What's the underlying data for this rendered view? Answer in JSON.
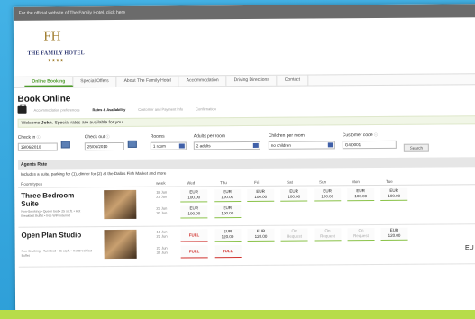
{
  "topbar": {
    "text": "For the official website of The Family Hotel, click here"
  },
  "logo": {
    "mark": "FH",
    "name": "THE FAMILY HOTEL",
    "stars": "★★★★"
  },
  "nav": [
    {
      "label": "Online Booking",
      "active": true
    },
    {
      "label": "Special Offers",
      "active": false
    },
    {
      "label": "About The Family Hotel",
      "active": false
    },
    {
      "label": "Accommodation",
      "active": false
    },
    {
      "label": "Driving Directions",
      "active": false
    },
    {
      "label": "Contact",
      "active": false
    }
  ],
  "page_title": "Book Online",
  "steps": [
    {
      "label": "Accommodation preferences",
      "active": false
    },
    {
      "label": "Rates & Availability",
      "active": true
    },
    {
      "label": "Customer and Payment Info",
      "active": false
    },
    {
      "label": "Confirmation",
      "active": false
    }
  ],
  "welcome": {
    "prefix": "Welcome",
    "name": "John",
    "suffix": ". Special rates are available for you!"
  },
  "form": {
    "checkin_label": "Check in",
    "checkin_value": "19/06/2010",
    "checkout_label": "Check out",
    "checkout_value": "25/06/2010",
    "rooms_label": "Rooms",
    "rooms_value": "1 room",
    "adults_label": "Adults per room",
    "adults_value": "2 adults",
    "children_label": "Children per room",
    "children_value": "no children",
    "code_label": "Customer code",
    "code_value": "G4I0001",
    "search_label": "Search"
  },
  "agents": {
    "title": "Agents Rate",
    "includes": "Includes a suite, parking for (1), dinner for (2) at the Dallas Fish Market and more"
  },
  "grid_head": {
    "room_types": "Room types",
    "week": "week",
    "days": [
      "Wed",
      "Thu",
      "Fri",
      "Sat",
      "Sun",
      "Mon",
      "Tue"
    ]
  },
  "rooms": [
    {
      "name": "Three Bedroom Suite",
      "desc": "Non-Smoking • Queen bed • 25 sq.ft. • Hot Breakfast Buffet • free WiFi internet",
      "rows": [
        {
          "date": "18 Jun\n22 Jun",
          "cells": [
            "EUR\n100.00",
            "EUR\n100.00",
            "EUR\n100.00",
            "EUR\n100.00",
            "EUR\n100.00",
            "EUR\n100.00",
            "EUR\n100.00"
          ]
        },
        {
          "date": "23 Jun\n30 Jun",
          "cells": [
            "EUR\n100.00",
            "EUR\n100.00"
          ]
        }
      ]
    },
    {
      "name": "Open Plan Studio",
      "desc": "Non-Smoking • Twin bed • 25 sq.ft. • Hot Breakfast Buffet",
      "rows": [
        {
          "date": "18 Jun\n22 Jun",
          "cells": [
            "FULL",
            "EUR\n120.00",
            "EUR\n120.00",
            "On\nRequest",
            "On\nRequest",
            "On\nRequest",
            "EUR\n120.00"
          ]
        },
        {
          "date": "23 Jun\n30 Jun",
          "cells": [
            "FULL",
            "FULL"
          ]
        }
      ]
    }
  ],
  "edge_text": "EU"
}
